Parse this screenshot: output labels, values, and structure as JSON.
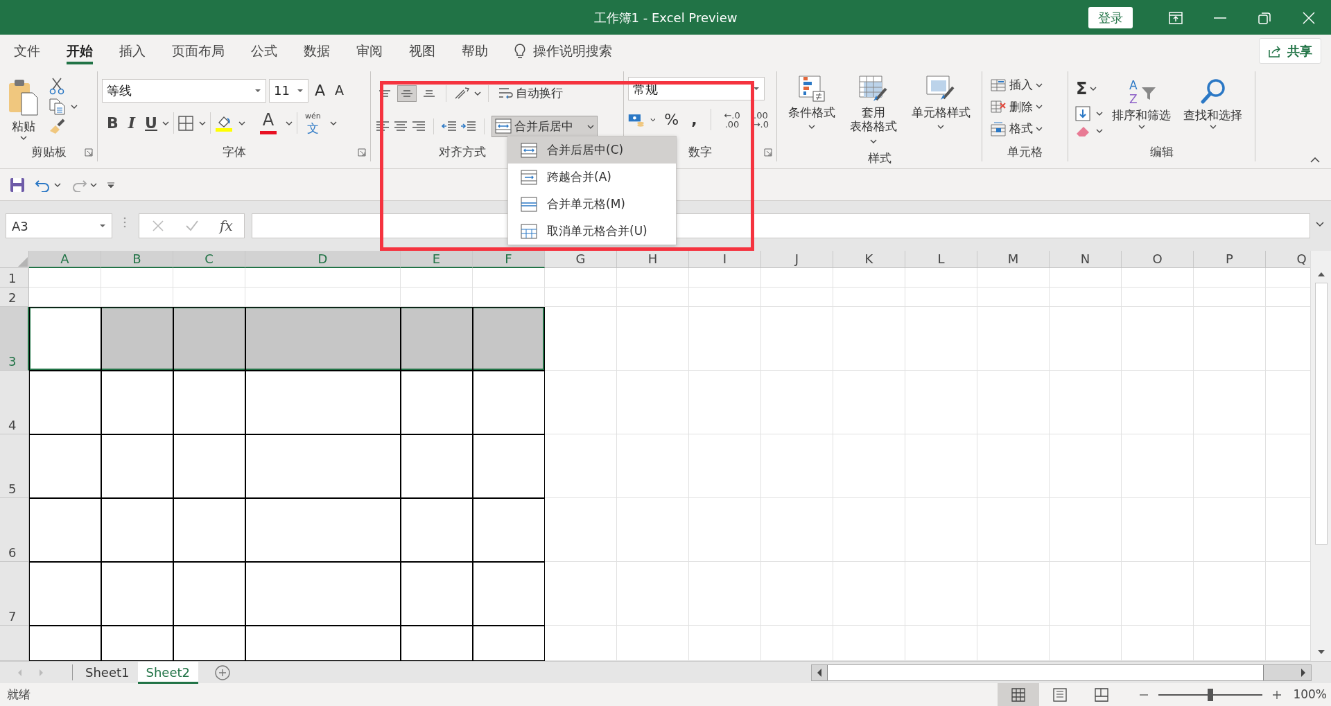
{
  "title_bar": {
    "title": "工作簿1 - Excel Preview",
    "sign_in": "登录"
  },
  "menu_tabs": [
    {
      "label": "文件",
      "selected": false
    },
    {
      "label": "开始",
      "selected": true
    },
    {
      "label": "插入",
      "selected": false
    },
    {
      "label": "页面布局",
      "selected": false
    },
    {
      "label": "公式",
      "selected": false
    },
    {
      "label": "数据",
      "selected": false
    },
    {
      "label": "审阅",
      "selected": false
    },
    {
      "label": "视图",
      "selected": false
    },
    {
      "label": "帮助",
      "selected": false
    }
  ],
  "tell_me": "操作说明搜索",
  "share": "共享",
  "ribbon": {
    "clipboard": {
      "label": "剪贴板",
      "paste": "粘贴"
    },
    "font": {
      "label": "字体",
      "font_name": "等线",
      "font_size": "11",
      "grow": "A",
      "shrink": "A",
      "style_buttons": [
        "B",
        "I",
        "U"
      ],
      "font_color_letter": "A",
      "phonetic": {
        "pinyin": "wén",
        "char": "文"
      }
    },
    "alignment": {
      "label": "对齐方式",
      "vertical_align": [
        {
          "kind": "top",
          "selected": false
        },
        {
          "kind": "middle",
          "selected": true
        },
        {
          "kind": "bottom",
          "selected": false
        }
      ],
      "wrap_text": "自动换行",
      "merge_button": "合并后居中",
      "merge_menu_open": true
    },
    "number": {
      "label": "数字",
      "format": "常规",
      "percent": "%",
      "comma": ",",
      "decimals": [
        {
          "top": "←.0",
          "bottom": ".00"
        },
        {
          "top": ".00",
          "bottom": "→.0"
        }
      ]
    },
    "styles": {
      "label": "样式",
      "buttons": [
        {
          "lines": [
            "条件格式"
          ]
        },
        {
          "lines": [
            "套用",
            "表格格式"
          ]
        },
        {
          "lines": [
            "单元格样式"
          ]
        }
      ]
    },
    "cells": {
      "label": "单元格",
      "buttons": [
        "插入",
        "删除",
        "格式"
      ]
    },
    "editing": {
      "label": "编辑",
      "sum": "Σ",
      "sort_letters": [
        "A",
        "Z"
      ],
      "sort": "排序和筛选",
      "find": "查找和选择"
    }
  },
  "formula_bar": {
    "name_box": "A3",
    "fx": "fx"
  },
  "dropdown_menu": [
    {
      "label": "合并后居中(C)",
      "selected": true
    },
    {
      "label": "跨越合并(A)",
      "selected": false
    },
    {
      "label": "合并单元格(M)",
      "selected": false
    },
    {
      "label": "取消单元格合并(U)",
      "selected": false
    }
  ],
  "annotation": {
    "kind": "frame"
  },
  "sheet": {
    "columns": [
      {
        "label": "A",
        "selected": true,
        "bordered": true,
        "kind": "normal"
      },
      {
        "label": "B",
        "selected": true,
        "bordered": true,
        "kind": "normal"
      },
      {
        "label": "C",
        "selected": true,
        "bordered": true,
        "kind": "normal"
      },
      {
        "label": "D",
        "selected": true,
        "bordered": true,
        "kind": "wide"
      },
      {
        "label": "E",
        "selected": true,
        "bordered": true,
        "kind": "normal"
      },
      {
        "label": "F",
        "selected": true,
        "bordered": true,
        "kind": "normal"
      },
      {
        "label": "G",
        "selected": false,
        "bordered": false,
        "kind": "normal"
      },
      {
        "label": "H",
        "selected": false,
        "bordered": false,
        "kind": "normal"
      },
      {
        "label": "I",
        "selected": false,
        "bordered": false,
        "kind": "normal"
      },
      {
        "label": "J",
        "selected": false,
        "bordered": false,
        "kind": "normal"
      },
      {
        "label": "K",
        "selected": false,
        "bordered": false,
        "kind": "normal"
      },
      {
        "label": "L",
        "selected": false,
        "bordered": false,
        "kind": "normal"
      },
      {
        "label": "M",
        "selected": false,
        "bordered": false,
        "kind": "normal"
      },
      {
        "label": "N",
        "selected": false,
        "bordered": false,
        "kind": "normal"
      },
      {
        "label": "O",
        "selected": false,
        "bordered": false,
        "kind": "normal"
      },
      {
        "label": "P",
        "selected": false,
        "bordered": false,
        "kind": "normal"
      },
      {
        "label": "Q",
        "selected": false,
        "bordered": false,
        "kind": "normal"
      }
    ],
    "rows": [
      {
        "label": "1",
        "selected": false,
        "bordered": false,
        "kind": "normal"
      },
      {
        "label": "2",
        "selected": false,
        "bordered": false,
        "kind": "normal"
      },
      {
        "label": "3",
        "selected": true,
        "bordered": true,
        "kind": "tall"
      },
      {
        "label": "4",
        "selected": false,
        "bordered": true,
        "kind": "tall"
      },
      {
        "label": "5",
        "selected": false,
        "bordered": true,
        "kind": "tall"
      },
      {
        "label": "6",
        "selected": false,
        "bordered": true,
        "kind": "tall"
      },
      {
        "label": "7",
        "selected": false,
        "bordered": true,
        "kind": "tall"
      }
    ]
  },
  "sheet_tabs": [
    {
      "label": "Sheet1",
      "selected": false
    },
    {
      "label": "Sheet2",
      "selected": true
    }
  ],
  "status_bar": {
    "status": "就绪",
    "view_buttons": [
      {
        "kind": "normal",
        "selected": true
      },
      {
        "kind": "page_layout",
        "selected": false
      },
      {
        "kind": "page_break",
        "selected": false
      }
    ],
    "zoom": {
      "level": 0.5,
      "reading": "100%"
    }
  }
}
